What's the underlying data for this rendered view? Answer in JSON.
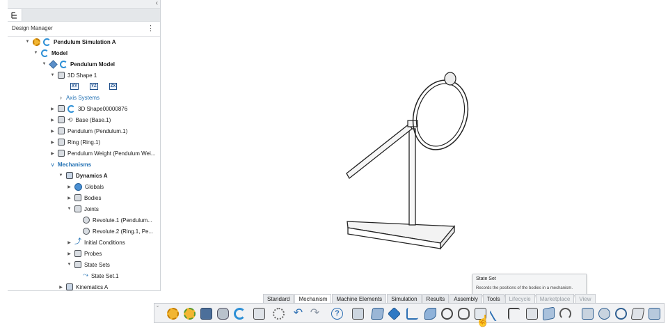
{
  "panel": {
    "title": "Design Manager",
    "collapse": "‹",
    "menu": "⋮"
  },
  "tree": [
    {
      "label": "Pendulum Simulation A",
      "toggle": "▼"
    },
    {
      "label": "Model",
      "toggle": "▼"
    },
    {
      "label": "Pendulum Model",
      "toggle": "▼"
    },
    {
      "label": "3D Shape 1",
      "toggle": "▼"
    },
    {
      "label": "Axis Systems",
      "toggle": "›"
    },
    {
      "label": "3D Shape00000876",
      "toggle": "▶"
    },
    {
      "label": "Base (Base.1)",
      "toggle": "▶"
    },
    {
      "label": "Pendulum (Pendulum.1)",
      "toggle": "▶"
    },
    {
      "label": "Ring (Ring.1)",
      "toggle": "▶"
    },
    {
      "label": "Pendulum Weight (Pendulum Wei...",
      "toggle": "▶"
    },
    {
      "label": "Mechanisms",
      "toggle": "∨"
    },
    {
      "label": "Dynamics A",
      "toggle": "▼"
    },
    {
      "label": "Globals",
      "toggle": "▶"
    },
    {
      "label": "Bodies",
      "toggle": "▶"
    },
    {
      "label": "Joints",
      "toggle": "▼"
    },
    {
      "label": "Revolute.1 (Pendulum...",
      "toggle": ""
    },
    {
      "label": "Revolute.2 (Ring.1, Pe...",
      "toggle": ""
    },
    {
      "label": "Initial Conditions",
      "toggle": "▶"
    },
    {
      "label": "Probes",
      "toggle": "▶"
    },
    {
      "label": "State Sets",
      "toggle": "▼"
    },
    {
      "label": "State Set.1",
      "toggle": ""
    },
    {
      "label": "Kinematics A",
      "toggle": "▶"
    }
  ],
  "axis_icons": [
    "XY",
    "YZ",
    "ZX"
  ],
  "ribbon": {
    "tabs": [
      "Standard",
      "Mechanism",
      "Machine Elements",
      "Simulation",
      "Results",
      "Assembly",
      "Tools",
      "Lifecycle",
      "Marketplace",
      "View"
    ],
    "active": "Mechanism"
  },
  "tooltip": {
    "title": "State Set",
    "description": "Records the positions of the bodies in a mechanism."
  },
  "toolbar": {
    "chevron": "ˇ"
  }
}
